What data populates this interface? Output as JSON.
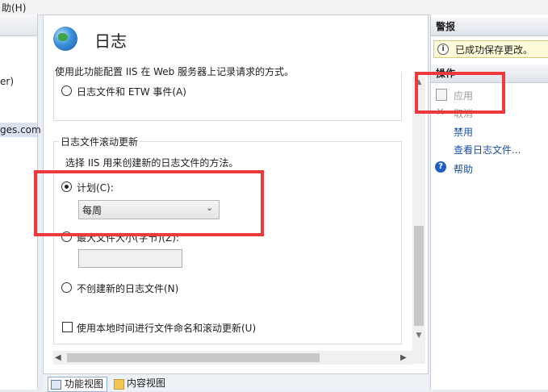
{
  "menu": {
    "help": "助(H)"
  },
  "left_tree": {
    "node_1": "er)",
    "node_2": "ges.com"
  },
  "main": {
    "title": "日志",
    "description": "使用此功能配置 IIS 在 Web 服务器上记录请求的方式。",
    "option_log_etw": "日志文件和 ETW 事件(A)",
    "rollover": {
      "group_title": "日志文件滚动更新",
      "description": "选择 IIS 用来创建新的日志文件的方法。",
      "schedule_label": "计划(C):",
      "schedule_selected": true,
      "schedule_value": "每周",
      "max_size_label": "最大文件大小(字节)(Z):",
      "max_size_value": "",
      "no_create_label": "不创建新的日志文件(N)",
      "local_time_label": "使用本地时间进行文件命名和滚动更新(U)",
      "local_time_checked": false
    }
  },
  "view_tabs": {
    "features": "功能视图",
    "content": "内容视图"
  },
  "right_pane": {
    "alerts_title": "警报",
    "alert_message": "已成功保存更改。",
    "actions_title": "操作",
    "apply": "应用",
    "cancel": "取消",
    "disable": "禁用",
    "view_logs": "查看日志文件...",
    "help": "帮助"
  },
  "colors": {
    "annotation": "#ee3a3a",
    "link": "#1a4fa3",
    "alert_bg": "#fffbd9"
  }
}
